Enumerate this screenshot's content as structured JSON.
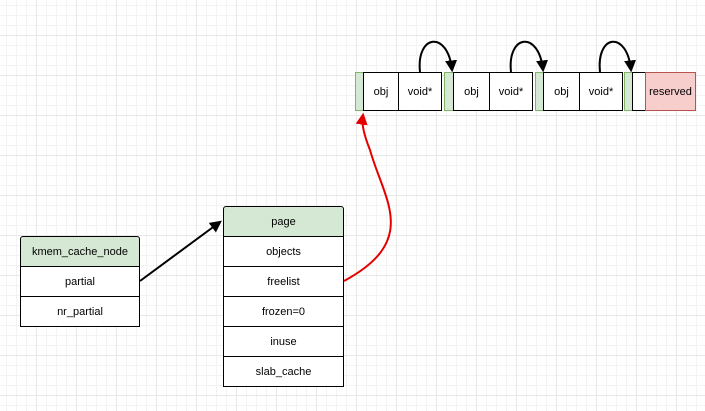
{
  "kmem_cache_node": {
    "title": "kmem_cache_node",
    "fields": [
      "partial",
      "nr_partial"
    ]
  },
  "page_struct": {
    "title": "page",
    "fields": [
      "objects",
      "freelist",
      "frozen=0",
      "inuse",
      "slab_cache"
    ]
  },
  "slab": {
    "obj_label": "obj",
    "ptr_label": "void*",
    "reserved_label": "reserved",
    "object_count": 3
  },
  "colors": {
    "header_fill": "#d5e8d4",
    "divider_stroke": "#82b366",
    "reserved_fill": "#f8cecc",
    "reserved_stroke": "#b85450",
    "freelist_arrow": "#e50000",
    "link_arrow": "#000000"
  }
}
